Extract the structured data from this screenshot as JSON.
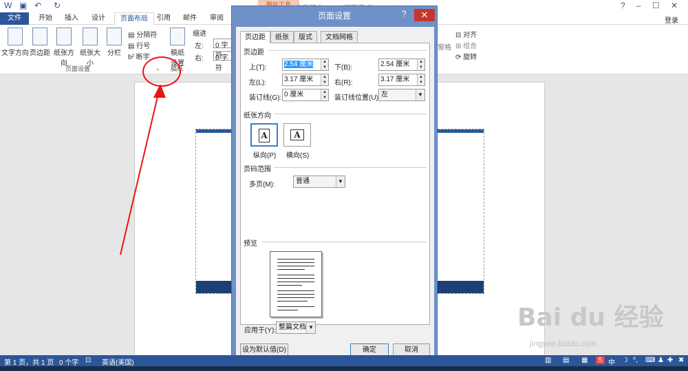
{
  "titlebar": {
    "title": "自我简介.docx [兼容模式] - Word",
    "contextual_tab": "图片工具",
    "login": "登录",
    "win_controls": [
      "?",
      "–",
      "☐",
      "✕"
    ]
  },
  "tabs": [
    "文件",
    "开始",
    "插入",
    "设计",
    "页面布局",
    "引用",
    "邮件",
    "审阅"
  ],
  "ribbon": {
    "buttons": [
      "文字方向",
      "页边距",
      "纸张方向",
      "纸张大小",
      "分栏"
    ],
    "small": [
      "分隔符",
      "行号",
      "断字"
    ],
    "group_page_setup": "页面设置",
    "draft_paper": [
      "稿纸",
      "设置"
    ],
    "group_draft": "稿纸",
    "indent": "缩进",
    "indent_left": "左:",
    "indent_left_val": "0 字符",
    "indent_right": "右:",
    "indent_right_val": "0 字符",
    "arrange": [
      "对齐",
      "组合",
      "旋转"
    ],
    "arrange_cut": "窗格"
  },
  "dialog": {
    "title": "页面设置",
    "help": "?",
    "close": "✕",
    "tabs": [
      "页边距",
      "纸张",
      "版式",
      "文档网格"
    ],
    "margins_heading": "页边距",
    "top_label": "上(T):",
    "top_value": "2.54 厘米",
    "bottom_label": "下(B):",
    "bottom_value": "2.54 厘米",
    "left_label": "左(L):",
    "left_value": "3.17 厘米",
    "right_label": "右(R):",
    "right_value": "3.17 厘米",
    "gutter_label": "装订线(G):",
    "gutter_value": "0 厘米",
    "gutter_pos_label": "装订线位置(U):",
    "gutter_pos_value": "左",
    "orientation_heading": "纸张方向",
    "portrait": "纵向(P)",
    "landscape": "横向(S)",
    "orient_glyph": "A",
    "pages_heading": "页码范围",
    "multi_label": "多页(M):",
    "multi_value": "普通",
    "preview_heading": "预览",
    "apply_label": "应用于(Y):",
    "apply_value": "整篇文档",
    "default_button": "设为默认值(D)",
    "ok_button": "确定",
    "cancel_button": "取消"
  },
  "status": {
    "page": "第 1 页，共 1 页",
    "words": "0 个字",
    "lang": "英语(美国)"
  },
  "watermark": {
    "logo": "Bai du 经验",
    "url": "jingyan.baidu.com"
  }
}
